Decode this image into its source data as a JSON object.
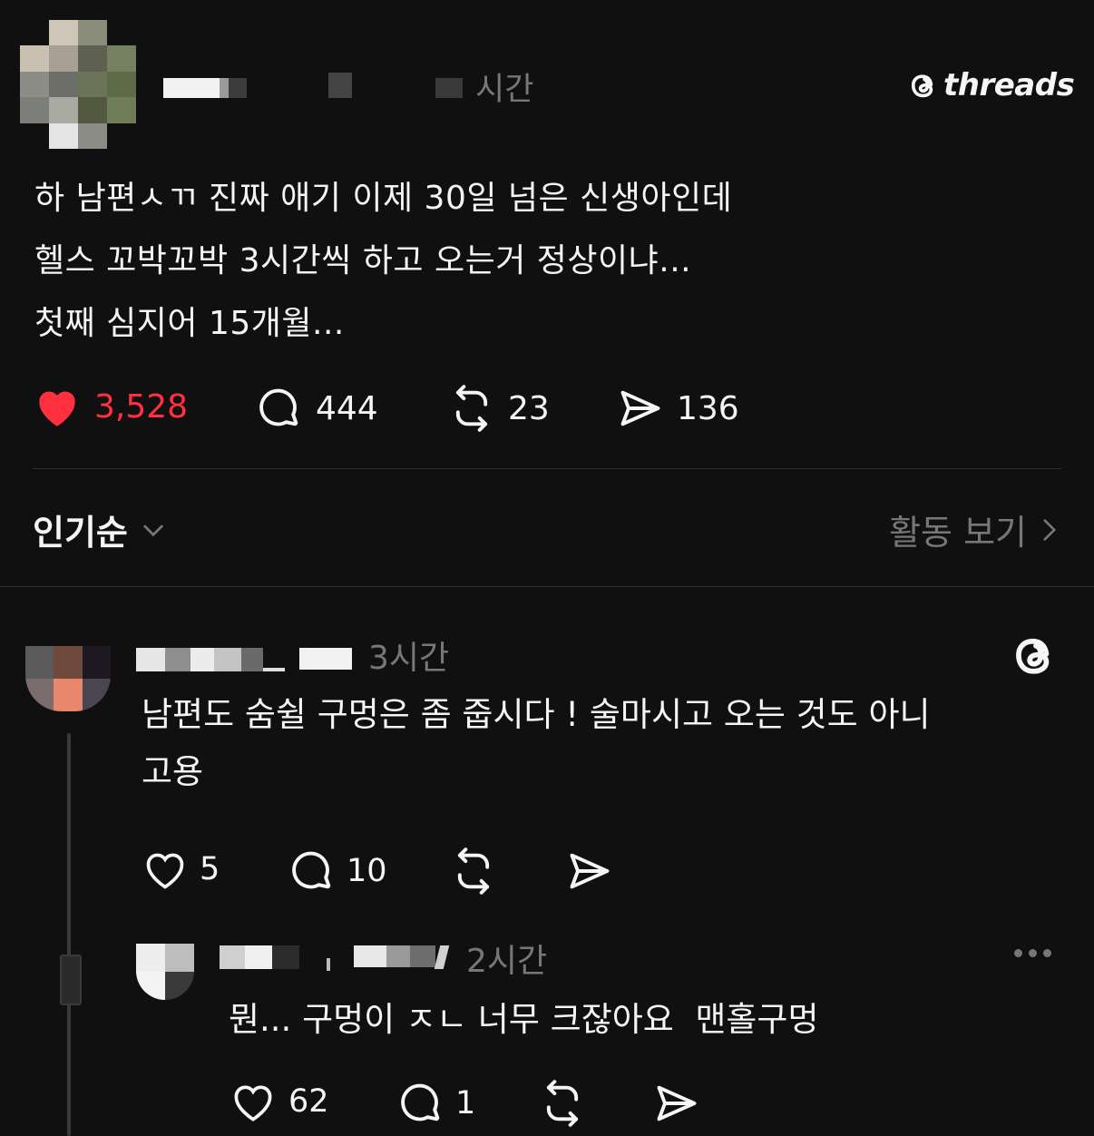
{
  "header": {
    "post_time": "시간",
    "brand_logo_text": "threads"
  },
  "post": {
    "lines": [
      "하 남편ㅅㄲ 진짜 애기 이제 30일 넘은 신생아인데",
      "헬스 꼬박꼬박 3시간씩 하고 오는거 정상이냐...",
      "첫째 심지어 15개월..."
    ],
    "likes": "3,528",
    "comments": "444",
    "reposts": "23",
    "shares": "136"
  },
  "sort": {
    "label": "인기순",
    "view_activity": "활동 보기"
  },
  "replies": [
    {
      "time": "3시간",
      "lines": [
        "남편도 숨쉴 구멍은 좀 줍시다 ! 술마시고 오는 것도 아니",
        "고용"
      ],
      "likes": "5",
      "comments": "10"
    },
    {
      "time": "2시간",
      "text": "뭔... 구멍이 ㅈㄴ 너무 크잖아요  맨홀구멍",
      "likes": "62",
      "comments": "1"
    }
  ],
  "colors": {
    "background": "#101010",
    "text": "#f3f5f7",
    "muted": "#777777",
    "like_red": "#ff3040"
  }
}
